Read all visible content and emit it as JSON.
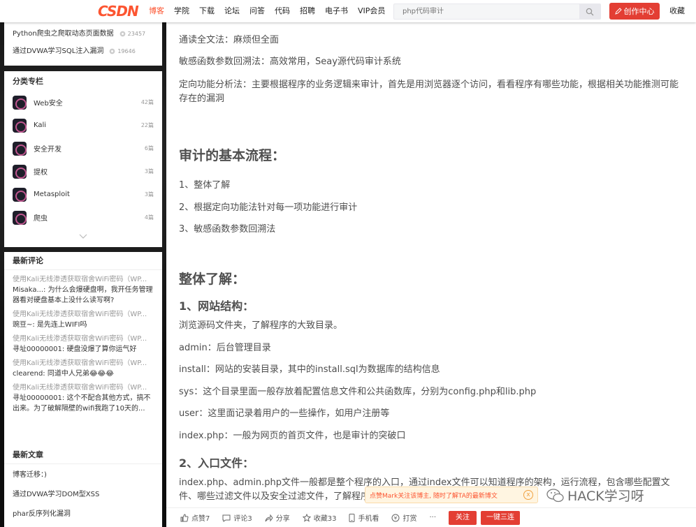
{
  "nav": {
    "logo": "CSDN",
    "links": [
      "博客",
      "学院",
      "下载",
      "论坛",
      "问答",
      "代码",
      "招聘",
      "电子书",
      "VIP会员"
    ],
    "search_placeholder": "php代码审计",
    "creator_label": "创作中心",
    "favorites_label": "收藏"
  },
  "sidebar": {
    "hot": [
      {
        "title": "Python爬虫之爬取动态页面数据",
        "views": "23457"
      },
      {
        "title": "通过DVWA学习SQL注入漏洞",
        "views": "19646"
      }
    ],
    "categories_title": "分类专栏",
    "categories": [
      {
        "name": "Web安全",
        "count": "42篇"
      },
      {
        "name": "Kali",
        "count": "22篇"
      },
      {
        "name": "安全开发",
        "count": "6篇"
      },
      {
        "name": "提权",
        "count": "3篇"
      },
      {
        "name": "Metasploit",
        "count": "3篇"
      },
      {
        "name": "爬虫",
        "count": "4篇"
      }
    ],
    "comments_title": "最新评论",
    "comments": [
      {
        "from": "使用Kali无线渗透获取宿舍WiFi密码（WP...",
        "text": "Misaka...: 为什么会爆硬盘啊，我开任务管理器看对硬盘基本上没什么读写啊?"
      },
      {
        "from": "使用Kali无线渗透获取宿舍WiFi密码（WP...",
        "text": "豌豆~: 是先连上WIFI吗"
      },
      {
        "from": "使用Kali无线渗透获取宿舍WiFi密码（WP...",
        "text": "寻址00000001: 硬盘没爆了算你运气好"
      },
      {
        "from": "使用Kali无线渗透获取宿舍WiFi密码（WP...",
        "text": "clearend: 同道中人兄弟😂😂😂"
      },
      {
        "from": "使用Kali无线渗透获取宿舍WiFi密码（WP...",
        "text": "寻址00000001: 这个不配合其他方式，搞不出来。为了破解隔壁的wifi我跑了10天的..."
      }
    ],
    "articles_title": "最新文章",
    "articles": [
      "博客迁移：)",
      "通过DVWA学习DOM型XSS",
      "phar反序列化漏洞"
    ]
  },
  "article": {
    "p1": "通读全文法：麻烦但全面",
    "p2": "敏感函数参数回溯法：高效常用，Seay源代码审计系统",
    "p3": "定向功能分析法：主要根据程序的业务逻辑来审计，首先是用浏览器逐个访问，看看程序有哪些功能，根据相关功能推测可能存在的漏洞",
    "h_flow": "审计的基本流程：",
    "flow": [
      "1、整体了解",
      "2、根据定向功能法针对每一项功能进行审计",
      "3、敏感函数参数回溯法"
    ],
    "h_overall": "整体了解：",
    "h_site": "1、网站结构：",
    "s1": "浏览源码文件夹，了解程序的大致目录。",
    "s2": "admin：后台管理目录",
    "s3": "install：网站的安装目录，其中的install.sql为数据库的结构信息",
    "s4": "sys：这个目录里面一般存放着配置信息文件和公共函数库，分别为config.php和lib.php",
    "s5": "user：这里面记录着用户的一些操作，如用户注册等",
    "s6": "index.php：一般为网页的首页文件，也是审计的突破口",
    "h_entry": "2、入口文件：",
    "e1": "index.php、admin.php文件一般都是整个程序的入口，通过index文件可以知道程序的架构，运行流程，包含哪些配置文件、哪些过滤文件以及安全过滤文件，了解程序的业务逻辑。"
  },
  "toolbar": {
    "like": "点赞7",
    "comment": "评论3",
    "share": "分享",
    "collect": "收藏33",
    "mobile": "手机看",
    "reward": "打赏",
    "more": "···",
    "follow": "关注",
    "triple": "一键三连"
  },
  "tip": {
    "text": "点赞Mark关注该博主, 随时了解TA的最新博文",
    "close": "x"
  },
  "watermark": "HACK学习呀"
}
